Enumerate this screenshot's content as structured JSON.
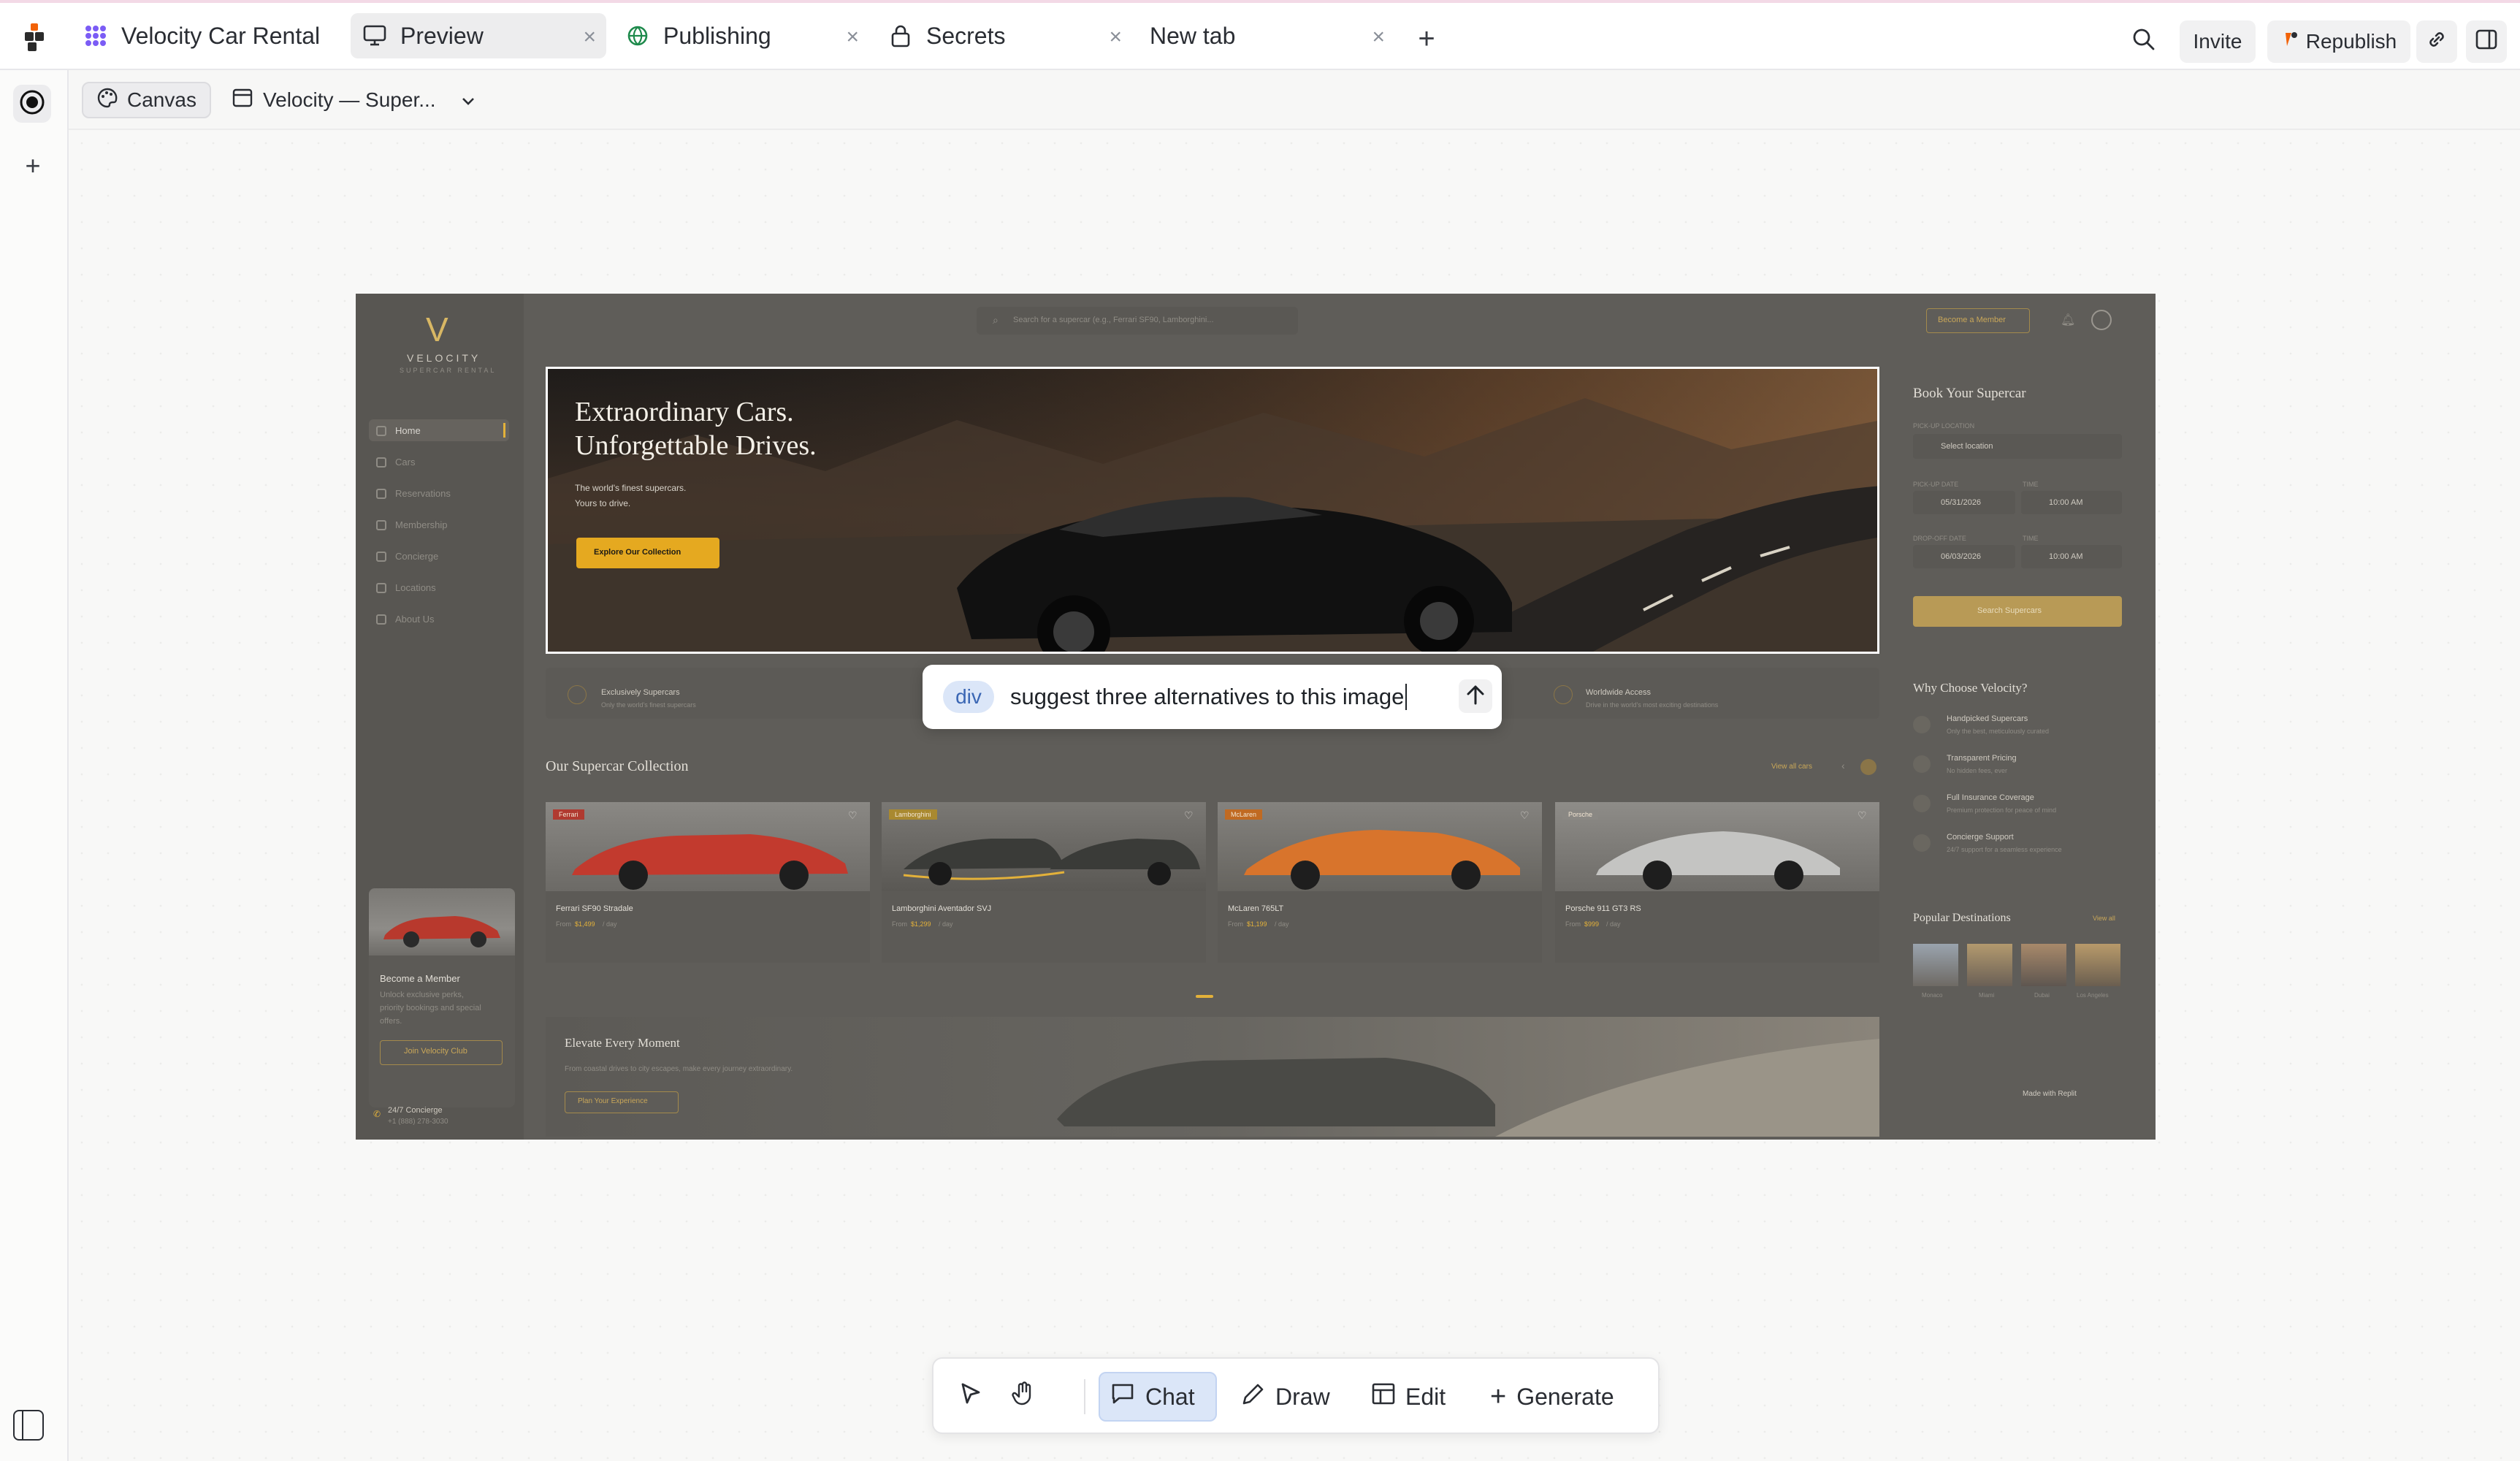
{
  "app": {
    "logo": "replit-logo-icon"
  },
  "tabs": [
    {
      "label": "Velocity Car Rental",
      "icon": "app-grid-icon",
      "active": false
    },
    {
      "label": "Preview",
      "icon": "monitor-icon",
      "active": true
    },
    {
      "label": "Publishing",
      "icon": "globe-icon",
      "active": false
    },
    {
      "label": "Secrets",
      "icon": "lock-icon",
      "active": false
    },
    {
      "label": "New tab",
      "icon": "",
      "active": false
    }
  ],
  "topbar": {
    "invite_label": "Invite",
    "republish_label": "Republish"
  },
  "canvasbar": {
    "canvas_label": "Canvas",
    "page_label": "Velocity — Super..."
  },
  "preview": {
    "brand": {
      "name": "VELOCITY",
      "tagline": "SUPERCAR RENTAL"
    },
    "search_placeholder": "Search for a supercar (e.g., Ferrari SF90, Lamborghini...",
    "become_member_btn": "Become a Member",
    "nav": [
      "Home",
      "Cars",
      "Reservations",
      "Membership",
      "Concierge",
      "Locations",
      "About Us"
    ],
    "hero": {
      "title_line1": "Extraordinary Cars.",
      "title_line2": "Unforgettable Drives.",
      "subtitle_line1": "The world's finest supercars.",
      "subtitle_line2": "Yours to drive.",
      "cta": "Explore Our Collection"
    },
    "booking": {
      "title": "Book Your Supercar",
      "pickup_location_label": "PICK-UP LOCATION",
      "location_value": "Select location",
      "pickup_date_label": "PICK-UP DATE",
      "time_label": "TIME",
      "pickup_date": "05/31/2026",
      "pickup_time": "10:00 AM",
      "dropoff_date_label": "DROP-OFF DATE",
      "dropoff_date": "06/03/2026",
      "dropoff_time": "10:00 AM",
      "search_btn": "Search Supercars"
    },
    "features": [
      {
        "title": "Exclusively Supercars",
        "desc": "Only the world's finest supercars"
      },
      {
        "title": "Worldwide Access",
        "desc": "Drive in the world's most exciting destinations"
      }
    ],
    "why": {
      "title": "Why Choose Velocity?",
      "items": [
        {
          "title": "Handpicked Supercars",
          "desc": "Only the best, meticulously curated"
        },
        {
          "title": "Transparent Pricing",
          "desc": "No hidden fees, ever"
        },
        {
          "title": "Full Insurance Coverage",
          "desc": "Premium protection for peace of mind"
        },
        {
          "title": "Concierge Support",
          "desc": "24/7 support for a seamless experience"
        }
      ]
    },
    "collection": {
      "title": "Our Supercar Collection",
      "view_all": "View all cars",
      "cars": [
        {
          "badge": "Ferrari",
          "name": "Ferrari SF90 Stradale",
          "price_prefix": "From",
          "price": "$1,499",
          "unit": "/ day",
          "color": "#c23a2e"
        },
        {
          "badge": "Lamborghini",
          "name": "Lamborghini Aventador SVJ",
          "price_prefix": "From",
          "price": "$1,299",
          "unit": "/ day",
          "color": "#3c3d3a"
        },
        {
          "badge": "McLaren",
          "name": "McLaren 765LT",
          "price_prefix": "From",
          "price": "$1,199",
          "unit": "/ day",
          "color": "#d8742c"
        },
        {
          "badge": "Porsche",
          "name": "Porsche 911 GT3 RS",
          "price_prefix": "From",
          "price": "$999",
          "unit": "/ day",
          "color": "#bdbdbb"
        }
      ]
    },
    "member": {
      "title": "Become a Member",
      "desc_line1": "Unlock exclusive perks,",
      "desc_line2": "priority bookings and special",
      "desc_line3": "offers.",
      "btn": "Join Velocity Club"
    },
    "concierge": {
      "label": "24/7 Concierge",
      "phone": "+1 (888) 278-3030"
    },
    "destinations": {
      "title": "Popular Destinations",
      "view_all": "View all",
      "items": [
        "Monaco",
        "Miami",
        "Dubai",
        "Los Angeles"
      ]
    },
    "elevate": {
      "title": "Elevate Every Moment",
      "desc": "From coastal drives to city escapes, make every journey extraordinary.",
      "btn": "Plan Your Experience"
    },
    "made_with": "Made with Replit"
  },
  "chat": {
    "tag": "div",
    "input_value": "suggest three alternatives to this image"
  },
  "toolbar": {
    "chat_label": "Chat",
    "draw_label": "Draw",
    "edit_label": "Edit",
    "generate_label": "Generate",
    "active": "Chat"
  },
  "colors": {
    "accent": "#e3b13a",
    "active_tab_bg": "#ededee",
    "chat_active_bg": "#dbe6f8",
    "chip_bg": "#dbe6f8"
  }
}
